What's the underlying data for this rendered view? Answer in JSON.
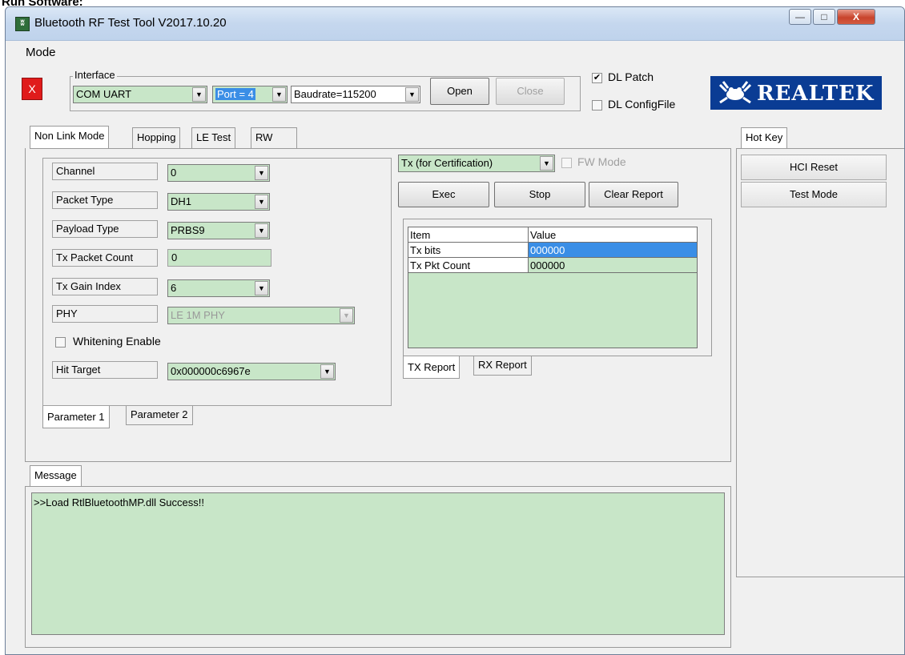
{
  "page_heading": "Run Software:",
  "window": {
    "title": "Bluetooth RF Test Tool V2017.10.20",
    "minimize_label": "—",
    "maximize_label": "□",
    "close_label": "X"
  },
  "menu": {
    "mode": "Mode"
  },
  "status_indicator": "X",
  "interface": {
    "group_label": "Interface",
    "type": "COM UART",
    "port": "Port = 4",
    "baudrate": "Baudrate=115200",
    "open_label": "Open",
    "close_label": "Close"
  },
  "options": {
    "dl_patch": {
      "label": "DL Patch",
      "checked": true
    },
    "dl_configfile": {
      "label": "DL ConfigFile",
      "checked": false
    }
  },
  "logo": {
    "text": "REALTEK"
  },
  "main_tabs": [
    "Non Link Mode",
    "Hopping",
    "LE Test",
    "RW"
  ],
  "parameters": {
    "channel": {
      "label": "Channel",
      "value": "0"
    },
    "packet_type": {
      "label": "Packet Type",
      "value": "DH1"
    },
    "payload_type": {
      "label": "Payload Type",
      "value": "PRBS9"
    },
    "tx_packet_count": {
      "label": "Tx Packet Count",
      "value": "0"
    },
    "tx_gain_index": {
      "label": "Tx Gain Index",
      "value": "6"
    },
    "phy": {
      "label": "PHY",
      "value": "LE 1M PHY"
    },
    "whitening": {
      "label": "Whitening Enable",
      "checked": false
    },
    "hit_target": {
      "label": "Hit Target",
      "value": "0x000000c6967e"
    }
  },
  "param_tabs": [
    "Parameter 1",
    "Parameter 2"
  ],
  "tx_mode": {
    "value": "Tx (for Certification)",
    "fw_mode_label": "FW Mode",
    "exec_label": "Exec",
    "stop_label": "Stop",
    "clear_label": "Clear Report"
  },
  "report": {
    "headers": [
      "Item",
      "Value"
    ],
    "rows": [
      {
        "item": "Tx bits",
        "value": "000000"
      },
      {
        "item": "Tx Pkt Count",
        "value": "000000"
      }
    ]
  },
  "report_tabs": [
    "TX Report",
    "RX Report"
  ],
  "hotkey": {
    "tab": "Hot Key",
    "hci_reset": "HCI Reset",
    "test_mode": "Test Mode"
  },
  "message": {
    "tab": "Message",
    "text": ">>Load RtlBluetoothMP.dll Success!!"
  },
  "colors": {
    "field_green": "#c8e6c8",
    "selection_blue": "#3a8ee6",
    "status_red": "#e01b1b",
    "logo_blue": "#0a3c94"
  }
}
